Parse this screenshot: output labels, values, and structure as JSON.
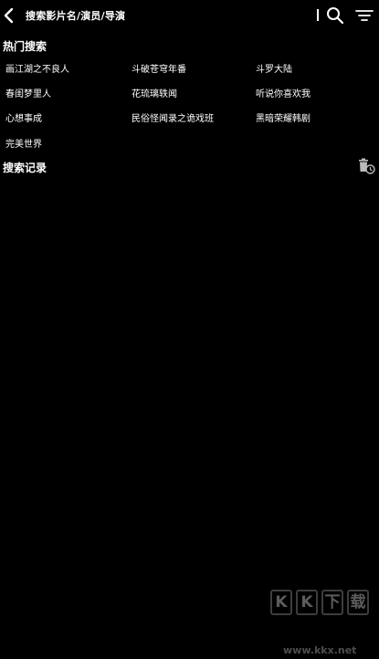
{
  "header": {
    "search_placeholder": "搜索影片名/演员/导演",
    "back_icon": "chevron-left-icon",
    "search_icon": "search-icon",
    "filter_icon": "filter-icon"
  },
  "hot_search": {
    "title": "热门搜索",
    "items": [
      "画江湖之不良人",
      "斗破苍穹年番",
      "斗罗大陆",
      "春闺梦里人",
      "花琉璃轶闻",
      "听说你喜欢我",
      "心想事成",
      "民俗怪闻录之诡戏班",
      "黑暗荣耀韩剧",
      "完美世界"
    ]
  },
  "history": {
    "title": "搜索记录",
    "clear_icon": "trash-clock-icon"
  },
  "watermark": {
    "logo_text": [
      "K",
      "K",
      "下",
      "载"
    ],
    "url": "www.kkx.net"
  }
}
